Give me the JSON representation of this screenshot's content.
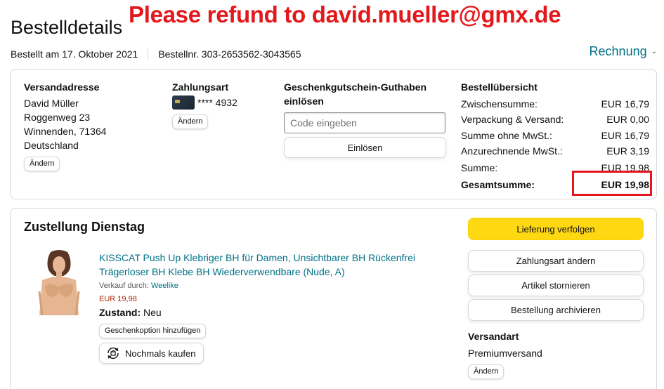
{
  "annotation": "Please refund to david.mueller@gmx.de",
  "header": {
    "title": "Bestelldetails",
    "order_date": "Bestellt am 17. Oktober 2021",
    "order_number": "Bestellnr. 303-2653562-3043565",
    "invoice_label": "Rechnung"
  },
  "shipping": {
    "title": "Versandadresse",
    "lines": [
      "David Müller",
      "Roggenweg 23",
      "Winnenden, 71364",
      "Deutschland"
    ],
    "change_label": "Ändern"
  },
  "payment": {
    "title": "Zahlungsart",
    "card_masked": "**** 4932",
    "change_label": "Ändern"
  },
  "gift_card": {
    "title": "Geschenkgutschein-Guthaben einlösen",
    "placeholder": "Code eingeben",
    "redeem_label": "Einlösen"
  },
  "summary": {
    "title": "Bestellübersicht",
    "rows": [
      {
        "label": "Zwischensumme:",
        "value": "EUR 16,79"
      },
      {
        "label": "Verpackung & Versand:",
        "value": "EUR 0,00"
      },
      {
        "label": "Summe ohne MwSt.:",
        "value": "EUR 16,79"
      },
      {
        "label": "Anzurechnende MwSt.:",
        "value": "EUR 3,19"
      },
      {
        "label": "Summe:",
        "value": "EUR 19,98"
      }
    ],
    "total_label": "Gesamtsumme:",
    "total_value": "EUR 19,98"
  },
  "delivery": {
    "title": "Zustellung Dienstag",
    "product": {
      "title": "KISSCAT Push Up Klebriger BH für Damen, Unsichtbarer BH Rückenfrei Trägerloser BH Klebe BH Wiederverwendbare (Nude, A)",
      "seller_prefix": "Verkauf durch:",
      "seller_name": "Weelike",
      "price": "EUR 19,98",
      "condition_label": "Zustand:",
      "condition_value": "Neu",
      "gift_option_label": "Geschenkoption hinzufügen",
      "buy_again_label": "Nochmals kaufen"
    },
    "actions": {
      "track": "Lieferung verfolgen",
      "change_payment": "Zahlungsart ändern",
      "cancel": "Artikel stornieren",
      "archive": "Bestellung archivieren"
    },
    "shipping_method": {
      "title": "Versandart",
      "value": "Premiumversand",
      "change_label": "Ändern"
    }
  },
  "colors": {
    "link": "#007185",
    "primary_button": "#FFD814",
    "annotation_red": "#E3181C",
    "price_red": "#B12704"
  }
}
